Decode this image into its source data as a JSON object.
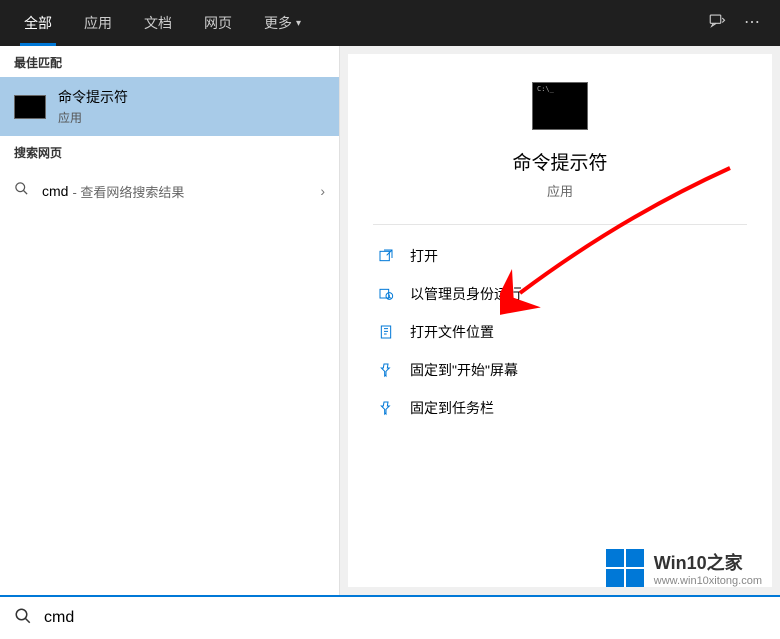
{
  "tabs": {
    "all": "全部",
    "apps": "应用",
    "docs": "文档",
    "web": "网页",
    "more": "更多"
  },
  "left": {
    "best_match_header": "最佳匹配",
    "result": {
      "title": "命令提示符",
      "subtitle": "应用"
    },
    "web_header": "搜索网页",
    "web_query": "cmd",
    "web_hint": "- 查看网络搜索结果"
  },
  "right": {
    "app_name": "命令提示符",
    "app_type": "应用",
    "actions": {
      "open": "打开",
      "run_admin": "以管理员身份运行",
      "open_location": "打开文件位置",
      "pin_start": "固定到\"开始\"屏幕",
      "pin_taskbar": "固定到任务栏"
    }
  },
  "watermark": {
    "title": "Win10之家",
    "url": "www.win10xitong.com"
  },
  "search": {
    "value": "cmd"
  }
}
